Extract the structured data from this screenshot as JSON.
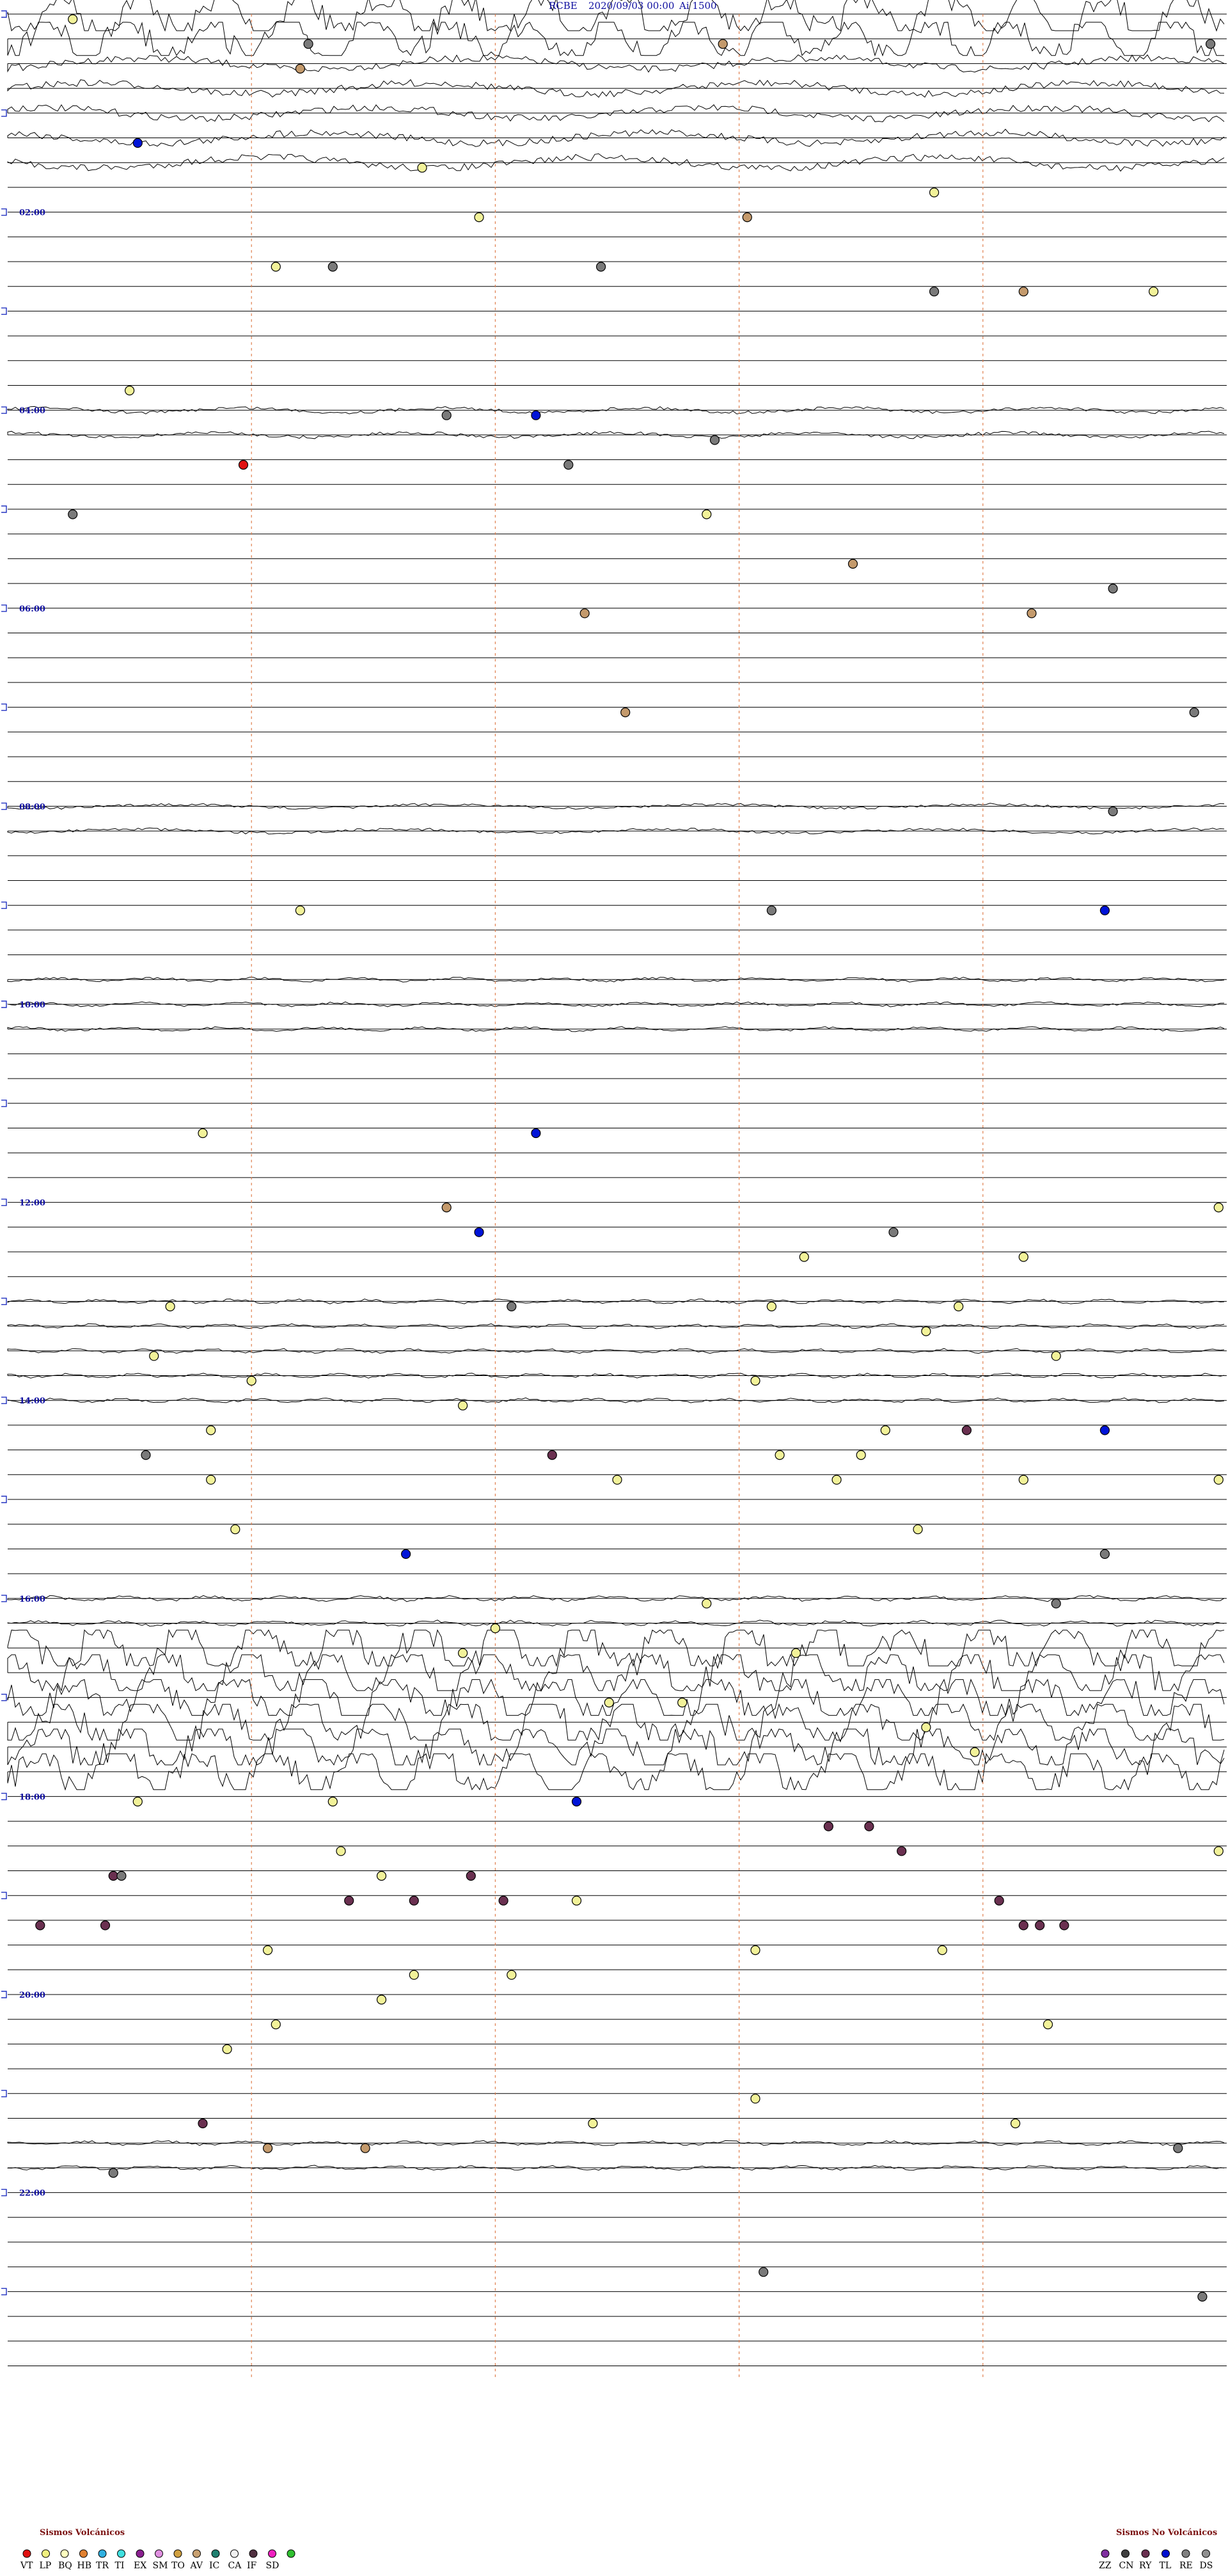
{
  "header": {
    "station": "RCBE",
    "date": "2020/09/03 00:00",
    "scale_label": "Ai 1500"
  },
  "chart_data": {
    "type": "scatter",
    "title": "RCBE  2020/09/03 00:00  Ai 1500",
    "y_hour_labels": [
      "02:00",
      "04:00",
      "06:00",
      "08:00",
      "10:00",
      "12:00",
      "14:00",
      "16:00",
      "18:00",
      "20:00",
      "22:00"
    ],
    "trace_count": 96,
    "minutes_per_trace": 15,
    "x_range_minutes": [
      0,
      15
    ],
    "dashed_marker_minutes": [
      3,
      6,
      9,
      12
    ],
    "events": [
      {
        "t": "00:00",
        "min": 0.8,
        "type": "LP"
      },
      {
        "t": "00:15",
        "min": 3.7,
        "type": "RE"
      },
      {
        "t": "00:15",
        "min": 8.8,
        "type": "AV"
      },
      {
        "t": "00:15",
        "min": 14.8,
        "type": "RE"
      },
      {
        "t": "00:30",
        "min": 3.6,
        "type": "AV"
      },
      {
        "t": "01:15",
        "min": 1.6,
        "type": "TL"
      },
      {
        "t": "01:30",
        "min": 5.1,
        "type": "LP"
      },
      {
        "t": "01:45",
        "min": 11.4,
        "type": "LP"
      },
      {
        "t": "02:00",
        "min": 5.8,
        "type": "LP"
      },
      {
        "t": "02:00",
        "min": 9.1,
        "type": "AV"
      },
      {
        "t": "02:30",
        "min": 3.3,
        "type": "LP"
      },
      {
        "t": "02:30",
        "min": 4.0,
        "type": "RE"
      },
      {
        "t": "02:30",
        "min": 7.3,
        "type": "RE"
      },
      {
        "t": "02:45",
        "min": 11.4,
        "type": "RE"
      },
      {
        "t": "02:45",
        "min": 12.5,
        "type": "AV"
      },
      {
        "t": "02:45",
        "min": 14.1,
        "type": "LP"
      },
      {
        "t": "03:45",
        "min": 1.5,
        "type": "LP"
      },
      {
        "t": "04:00",
        "min": 6.5,
        "type": "TL"
      },
      {
        "t": "04:00",
        "min": 5.4,
        "type": "RE"
      },
      {
        "t": "04:15",
        "min": 8.7,
        "type": "RE"
      },
      {
        "t": "04:30",
        "min": 2.9,
        "type": "VT"
      },
      {
        "t": "04:30",
        "min": 6.9,
        "type": "RE"
      },
      {
        "t": "05:00",
        "min": 0.8,
        "type": "RE"
      },
      {
        "t": "05:00",
        "min": 8.6,
        "type": "LP"
      },
      {
        "t": "05:30",
        "min": 10.4,
        "type": "AV"
      },
      {
        "t": "05:45",
        "min": 13.6,
        "type": "RE"
      },
      {
        "t": "06:00",
        "min": 7.1,
        "type": "AV"
      },
      {
        "t": "06:00",
        "min": 12.6,
        "type": "AV"
      },
      {
        "t": "07:00",
        "min": 7.6,
        "type": "AV"
      },
      {
        "t": "07:00",
        "min": 14.6,
        "type": "RE"
      },
      {
        "t": "08:00",
        "min": 13.6,
        "type": "RE"
      },
      {
        "t": "09:00",
        "min": 9.4,
        "type": "RE"
      },
      {
        "t": "09:00",
        "min": 13.5,
        "type": "TL"
      },
      {
        "t": "09:00",
        "min": 3.6,
        "type": "LP"
      },
      {
        "t": "11:15",
        "min": 6.5,
        "type": "TL"
      },
      {
        "t": "11:15",
        "min": 2.4,
        "type": "LP"
      },
      {
        "t": "12:00",
        "min": 14.9,
        "type": "LP"
      },
      {
        "t": "12:00",
        "min": 5.4,
        "type": "AV"
      },
      {
        "t": "12:15",
        "min": 10.9,
        "type": "RE"
      },
      {
        "t": "12:15",
        "min": 5.8,
        "type": "TL"
      },
      {
        "t": "12:30",
        "min": 9.8,
        "type": "LP"
      },
      {
        "t": "12:30",
        "min": 12.5,
        "type": "LP"
      },
      {
        "t": "13:00",
        "min": 6.2,
        "type": "RE"
      },
      {
        "t": "13:00",
        "min": 9.4,
        "type": "LP"
      },
      {
        "t": "13:00",
        "min": 11.7,
        "type": "LP"
      },
      {
        "t": "13:00",
        "min": 2.0,
        "type": "LP"
      },
      {
        "t": "13:15",
        "min": 11.3,
        "type": "LP"
      },
      {
        "t": "13:30",
        "min": 1.8,
        "type": "LP"
      },
      {
        "t": "13:30",
        "min": 12.9,
        "type": "LP"
      },
      {
        "t": "13:45",
        "min": 3.0,
        "type": "LP"
      },
      {
        "t": "13:45",
        "min": 9.2,
        "type": "LP"
      },
      {
        "t": "14:00",
        "min": 5.6,
        "type": "LP"
      },
      {
        "t": "14:15",
        "min": 2.5,
        "type": "LP"
      },
      {
        "t": "14:15",
        "min": 10.8,
        "type": "LP"
      },
      {
        "t": "14:15",
        "min": 11.8,
        "type": "CA"
      },
      {
        "t": "14:15",
        "min": 13.5,
        "type": "TL"
      },
      {
        "t": "14:30",
        "min": 1.7,
        "type": "RE"
      },
      {
        "t": "14:30",
        "min": 6.7,
        "type": "CA"
      },
      {
        "t": "14:30",
        "min": 10.5,
        "type": "LP"
      },
      {
        "t": "14:30",
        "min": 9.5,
        "type": "LP"
      },
      {
        "t": "14:45",
        "min": 2.5,
        "type": "LP"
      },
      {
        "t": "14:45",
        "min": 7.5,
        "type": "LP"
      },
      {
        "t": "14:45",
        "min": 10.2,
        "type": "LP"
      },
      {
        "t": "14:45",
        "min": 12.5,
        "type": "LP"
      },
      {
        "t": "14:45",
        "min": 14.9,
        "type": "LP"
      },
      {
        "t": "15:15",
        "min": 2.8,
        "type": "LP"
      },
      {
        "t": "15:15",
        "min": 11.2,
        "type": "LP"
      },
      {
        "t": "15:30",
        "min": 4.9,
        "type": "TL"
      },
      {
        "t": "15:30",
        "min": 13.5,
        "type": "RE"
      },
      {
        "t": "16:00",
        "min": 8.6,
        "type": "LP"
      },
      {
        "t": "16:00",
        "min": 12.9,
        "type": "RE"
      },
      {
        "t": "16:15",
        "min": 6.0,
        "type": "LP"
      },
      {
        "t": "16:30",
        "min": 5.6,
        "type": "LP"
      },
      {
        "t": "16:30",
        "min": 9.7,
        "type": "LP"
      },
      {
        "t": "17:00",
        "min": 8.3,
        "type": "LP"
      },
      {
        "t": "17:00",
        "min": 7.4,
        "type": "LP"
      },
      {
        "t": "17:15",
        "min": 11.3,
        "type": "LP"
      },
      {
        "t": "17:30",
        "min": 11.9,
        "type": "LP"
      },
      {
        "t": "18:00",
        "min": 1.6,
        "type": "LP"
      },
      {
        "t": "18:00",
        "min": 4.0,
        "type": "LP"
      },
      {
        "t": "18:00",
        "min": 7.0,
        "type": "TL"
      },
      {
        "t": "18:15",
        "min": 10.6,
        "type": "CA"
      },
      {
        "t": "18:15",
        "min": 10.1,
        "type": "CA"
      },
      {
        "t": "18:30",
        "min": 4.1,
        "type": "LP"
      },
      {
        "t": "18:30",
        "min": 11.0,
        "type": "CA"
      },
      {
        "t": "18:30",
        "min": 14.9,
        "type": "LP"
      },
      {
        "t": "18:45",
        "min": 1.3,
        "type": "CA"
      },
      {
        "t": "18:45",
        "min": 1.4,
        "type": "RE"
      },
      {
        "t": "18:45",
        "min": 4.6,
        "type": "LP"
      },
      {
        "t": "18:45",
        "min": 5.7,
        "type": "CA"
      },
      {
        "t": "19:00",
        "min": 4.2,
        "type": "CA"
      },
      {
        "t": "19:00",
        "min": 5.0,
        "type": "CA"
      },
      {
        "t": "19:00",
        "min": 6.1,
        "type": "CA"
      },
      {
        "t": "19:00",
        "min": 7.0,
        "type": "LP"
      },
      {
        "t": "19:00",
        "min": 12.2,
        "type": "CA"
      },
      {
        "t": "19:15",
        "min": 0.4,
        "type": "CA"
      },
      {
        "t": "19:15",
        "min": 1.2,
        "type": "CA"
      },
      {
        "t": "19:15",
        "min": 12.5,
        "type": "CA"
      },
      {
        "t": "19:15",
        "min": 12.7,
        "type": "CA"
      },
      {
        "t": "19:15",
        "min": 13.0,
        "type": "CA"
      },
      {
        "t": "19:30",
        "min": 3.2,
        "type": "LP"
      },
      {
        "t": "19:30",
        "min": 9.2,
        "type": "LP"
      },
      {
        "t": "19:30",
        "min": 11.5,
        "type": "LP"
      },
      {
        "t": "19:45",
        "min": 5.0,
        "type": "LP"
      },
      {
        "t": "19:45",
        "min": 6.2,
        "type": "LP"
      },
      {
        "t": "20:00",
        "min": 4.6,
        "type": "LP"
      },
      {
        "t": "20:15",
        "min": 3.3,
        "type": "LP"
      },
      {
        "t": "20:15",
        "min": 12.8,
        "type": "LP"
      },
      {
        "t": "20:30",
        "min": 2.7,
        "type": "LP"
      },
      {
        "t": "21:00",
        "min": 9.2,
        "type": "LP"
      },
      {
        "t": "21:15",
        "min": 2.4,
        "type": "CA"
      },
      {
        "t": "21:15",
        "min": 7.2,
        "type": "LP"
      },
      {
        "t": "21:15",
        "min": 12.4,
        "type": "LP"
      },
      {
        "t": "21:30",
        "min": 3.2,
        "type": "AV"
      },
      {
        "t": "21:30",
        "min": 4.4,
        "type": "AV"
      },
      {
        "t": "21:30",
        "min": 14.4,
        "type": "RE"
      },
      {
        "t": "21:45",
        "min": 1.3,
        "type": "RE"
      },
      {
        "t": "22:45",
        "min": 9.3,
        "type": "RE"
      },
      {
        "t": "23:00",
        "min": 14.7,
        "type": "RE"
      }
    ],
    "legend_volcanic": {
      "title": "Sismos Volcánicos",
      "items": [
        {
          "code": "VT",
          "color": "#e01010"
        },
        {
          "code": "LP",
          "color": "#f0f080"
        },
        {
          "code": "BQ",
          "color": "#ffffc0"
        },
        {
          "code": "HB",
          "color": "#e08030"
        },
        {
          "code": "TR",
          "color": "#30b0e0"
        },
        {
          "code": "TI",
          "color": "#40e0e0"
        },
        {
          "code": "EX",
          "color": "#8a2090"
        },
        {
          "code": "SM",
          "color": "#e090e0"
        },
        {
          "code": "TO",
          "color": "#d0a040"
        },
        {
          "code": "AV",
          "color": "#c8a070"
        },
        {
          "code": "IC",
          "color": "#208070"
        },
        {
          "code": "CA",
          "color": "#f0f0f0"
        },
        {
          "code": "IF",
          "color": "#503040"
        },
        {
          "code": "SD",
          "color": "#f020c0"
        },
        {
          "code": "SD2",
          "color": "#30c030"
        }
      ]
    },
    "legend_non_volcanic": {
      "title": "Sismos No Volcánicos",
      "items": [
        {
          "code": "ZZ",
          "color": "#8030a0"
        },
        {
          "code": "CN",
          "color": "#404040"
        },
        {
          "code": "RY",
          "color": "#6a3050"
        },
        {
          "code": "TL",
          "color": "#0010d0"
        },
        {
          "code": "RE",
          "color": "#808080"
        },
        {
          "code": "DS",
          "color": "#909090"
        }
      ]
    },
    "type_colors": {
      "VT": "#e01010",
      "LP": "#f2f299",
      "AV": "#c49a6c",
      "RE": "#7a7a7a",
      "TL": "#0014d8",
      "CA": "#6a3050"
    }
  }
}
